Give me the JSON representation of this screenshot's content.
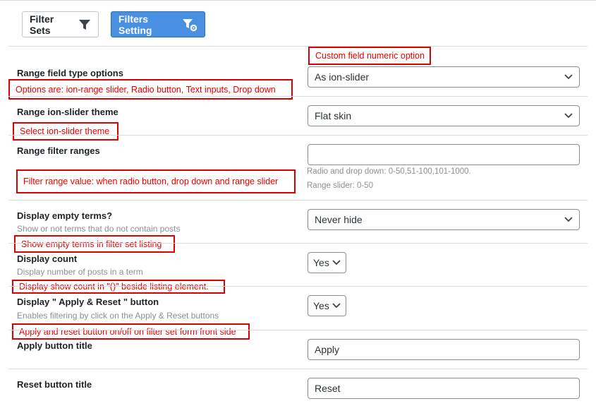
{
  "tabs": {
    "filter_sets": "Filter Sets",
    "filters_setting": "Filters Setting"
  },
  "notes": {
    "custom_field": "Custom field numeric option",
    "range_options": "Options are: ion-range slider, Radio button, Text inputs, Drop down",
    "theme": "Select ion-slider theme",
    "range_value": "Filter range value: when radio button, drop down and range slider",
    "empty_terms": "Show empty terms in filter set listing",
    "show_count": "Display show count in \"()\" beside listing element.",
    "apply_reset": "Apply and reset button on/off on filter set form front side"
  },
  "fields": {
    "range_type": {
      "label": "Range field type options",
      "value": "As ion-slider"
    },
    "theme": {
      "label": "Range ion-slider theme",
      "value": "Flat skin"
    },
    "ranges": {
      "label": "Range filter ranges",
      "value": "",
      "hint1": "Radio and drop down: 0-50,51-100,101-1000.",
      "hint2": "Range slider: 0-50"
    },
    "empty_terms": {
      "label": "Display empty terms?",
      "desc": "Show or not terms that do not contain posts",
      "value": "Never hide"
    },
    "count": {
      "label": "Display count",
      "desc": "Display number of posts in a term",
      "value": "Yes"
    },
    "apply_reset": {
      "label": "Display \" Apply & Reset \" button",
      "desc": "Enables filtering by click on the Apply & Reset buttons",
      "value": "Yes"
    },
    "apply_title": {
      "label": "Apply button title",
      "value": "Apply"
    },
    "reset_title": {
      "label": "Reset button title",
      "value": "Reset"
    }
  },
  "colors": {
    "accent": "#4a90e2",
    "annotation": "#dd0000",
    "border": "#8c8f94"
  },
  "icons": [
    "filter-icon",
    "filter-gear-icon",
    "chevron-down-icon"
  ]
}
